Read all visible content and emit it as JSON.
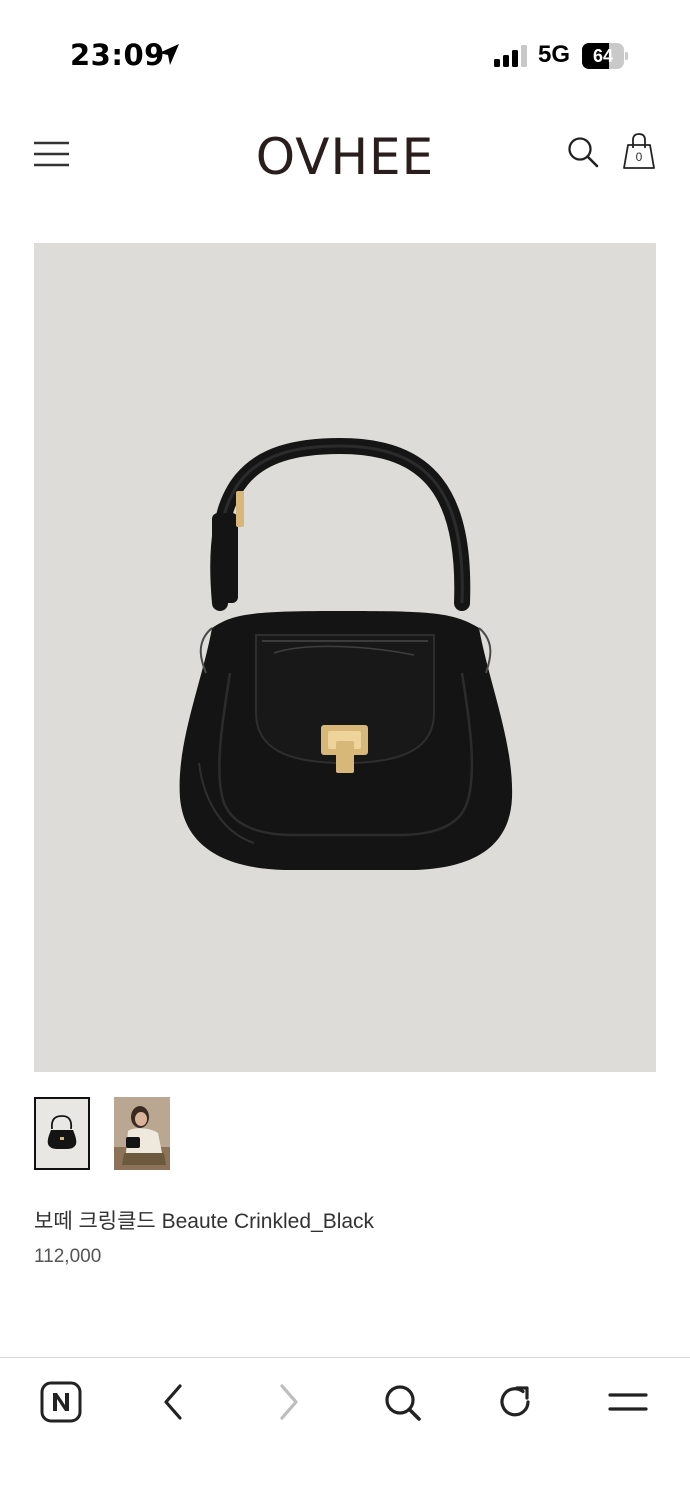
{
  "status_bar": {
    "time": "23:09",
    "network": "5G",
    "battery": "64",
    "battery_level": 0.64
  },
  "header": {
    "logo": "OVHEE",
    "cart_count": "0",
    "icons": [
      "menu-icon",
      "search-icon",
      "shopping-bag-icon"
    ]
  },
  "product": {
    "name": "보떼 크링클드 Beaute Crinkled_Black",
    "price": "112,000",
    "thumbnails": [
      "thumbnail-bag-front",
      "thumbnail-model-with-bag"
    ],
    "selected_thumbnail": 0
  },
  "browser_bar": {
    "icons": [
      "naver-home-icon",
      "back-icon",
      "forward-icon",
      "search-icon",
      "refresh-icon",
      "menu-icon"
    ]
  },
  "colors": {
    "image_background": "#dddcd8",
    "logo": "#2a1d1d",
    "bag": "#141414",
    "hardware_gold": "#d8b878"
  }
}
